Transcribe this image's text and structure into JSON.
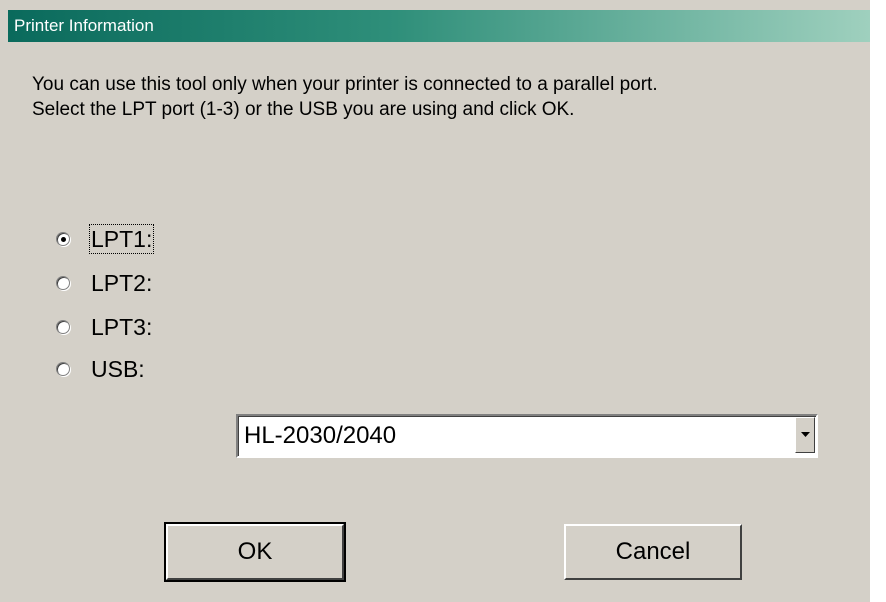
{
  "window": {
    "title": "Printer Information"
  },
  "message": {
    "line1": "You can use this tool only when your printer is connected to a parallel port.",
    "line2": "Select the LPT port (1-3) or the USB you are using and click OK."
  },
  "ports": {
    "options": [
      {
        "label": "LPT1:",
        "selected": true
      },
      {
        "label": "LPT2:",
        "selected": false
      },
      {
        "label": "LPT3:",
        "selected": false
      },
      {
        "label": "USB:",
        "selected": false
      }
    ]
  },
  "printer_select": {
    "value": "HL-2030/2040"
  },
  "buttons": {
    "ok_label": "OK",
    "cancel_label": "Cancel"
  },
  "colors": {
    "dialog_background": "#d4d0c8",
    "titlebar_start": "#0a6a5c",
    "titlebar_end": "#9fd0be"
  },
  "icons": {
    "dropdown": "chevron-down-icon"
  }
}
